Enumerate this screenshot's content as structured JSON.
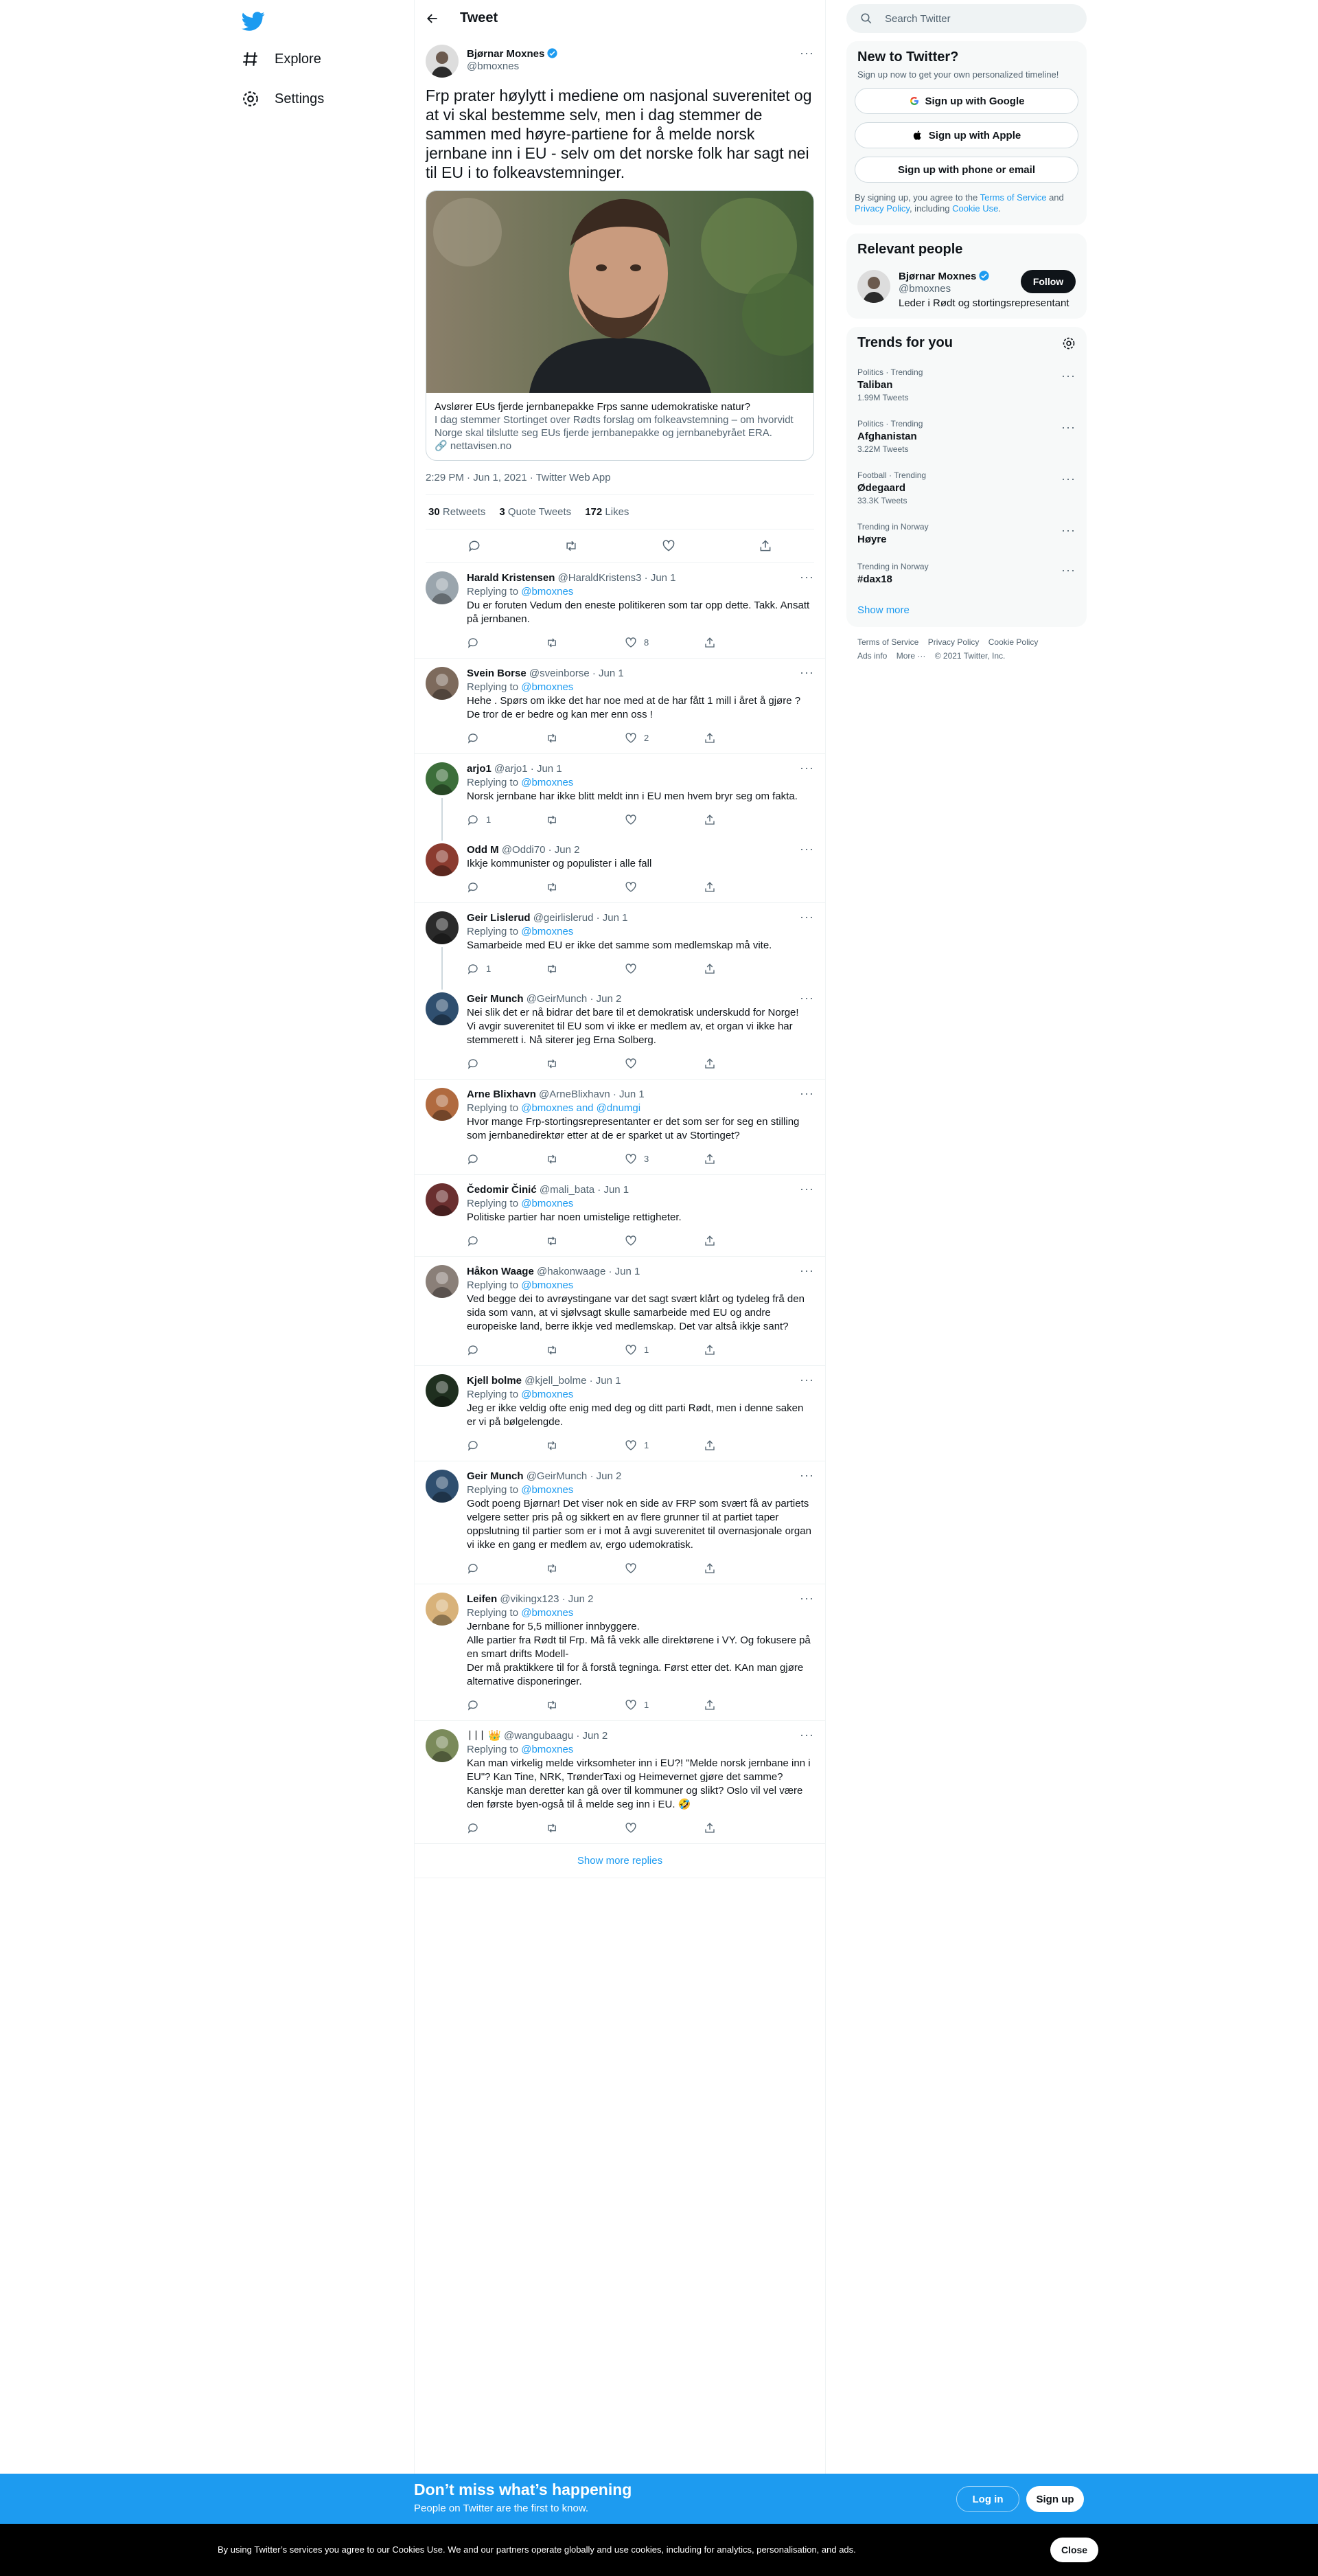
{
  "colors": {
    "accent": "#1d9bf0",
    "text": "#0f1419",
    "secondary": "#536471"
  },
  "nav": {
    "explore": "Explore",
    "settings": "Settings"
  },
  "header": {
    "title": "Tweet"
  },
  "tweet": {
    "name": "Bjørnar Moxnes",
    "handle": "@bmoxnes",
    "text": "Frp prater høylytt i mediene om nasjonal suverenitet og at vi skal bestemme selv, men i dag stemmer de sammen med høyre-partiene for å melde norsk jernbane inn i EU - selv om det norske folk har sagt nei til EU i to folkeavstemninger.",
    "card": {
      "title": "Avslører EUs fjerde jernbanepakke Frps sanne udemokratiske natur?",
      "desc": "I dag stemmer Stortinget over Rødts forslag om folkeavstemning – om hvorvidt Norge skal tilslutte seg EUs fjerde jernbanepakke og jernbanebyrået ERA.",
      "domain": "nettavisen.no"
    },
    "time": "2:29 PM · Jun 1, 2021 · Twitter Web App",
    "retweets": "30",
    "retweets_label": "Retweets",
    "quotes": "3",
    "quotes_label": "Quote Tweets",
    "likes": "172",
    "likes_label": "Likes"
  },
  "replies": [
    {
      "name": "Harald Kristensen",
      "handle": "@HaraldKristens3 · Jun 1",
      "replying": "Replying to",
      "to": "@bmoxnes",
      "text": "Du er foruten Vedum den eneste politikeren som tar opp dette. Takk. Ansatt på jernbanen.",
      "reply_count": "",
      "retweet_count": "",
      "like_count": "8"
    },
    {
      "name": "Svein Borse",
      "handle": "@sveinborse · Jun 1",
      "replying": "Replying to",
      "to": "@bmoxnes",
      "text": "Hehe . Spørs om ikke det har noe med at de har fått 1 mill i året å gjøre ? De tror de er bedre og kan mer enn oss !",
      "reply_count": "",
      "retweet_count": "",
      "like_count": "2"
    },
    {
      "name": "arjo1",
      "handle": "@arjo1 · Jun 1",
      "replying": "Replying to",
      "to": "@bmoxnes",
      "text": "Norsk jernbane har ikke blitt meldt inn i EU men hvem bryr seg om fakta.",
      "reply_count": "1",
      "retweet_count": "",
      "like_count": ""
    },
    {
      "name": "Odd M",
      "handle": "@Oddi70 · Jun 2",
      "replying": "",
      "to": "",
      "text": "Ikkje kommunister og populister i alle fall",
      "reply_count": "",
      "retweet_count": "",
      "like_count": ""
    },
    {
      "name": "Geir Lislerud",
      "handle": "@geirlislerud · Jun 1",
      "replying": "Replying to",
      "to": "@bmoxnes",
      "text": "Samarbeide med EU er ikke det samme som medlemskap må vite.",
      "reply_count": "1",
      "retweet_count": "",
      "like_count": ""
    },
    {
      "name": "Geir Munch",
      "handle": "@GeirMunch · Jun 2",
      "replying": "",
      "to": "",
      "text": "Nei slik det er nå bidrar det bare til et demokratisk underskudd for Norge!\nVi avgir suverenitet til EU som vi ikke er medlem av, et organ vi ikke har stemmerett i. Nå siterer jeg Erna Solberg.",
      "reply_count": "",
      "retweet_count": "",
      "like_count": ""
    },
    {
      "name": "Arne Blixhavn",
      "handle": "@ArneBlixhavn · Jun 1",
      "replying": "Replying to",
      "to": "@bmoxnes and @dnumgi",
      "text": "Hvor mange Frp-stortingsrepresentanter er det som ser for seg en stilling som jernbanedirektør etter at de er sparket ut av Stortinget?",
      "reply_count": "",
      "retweet_count": "",
      "like_count": "3"
    },
    {
      "name": "Čedomir Činić",
      "handle": "@mali_bata · Jun 1",
      "replying": "Replying to",
      "to": "@bmoxnes",
      "text": "Politiske partier har noen umistelige rettigheter.",
      "reply_count": "",
      "retweet_count": "",
      "like_count": ""
    },
    {
      "name": "Håkon Waage",
      "handle": "@hakonwaage · Jun 1",
      "replying": "Replying to",
      "to": "@bmoxnes",
      "text": "Ved begge dei to avrøystingane var det sagt svært klårt og tydeleg frå den sida som vann, at vi sjølvsagt skulle samarbeide med EU og andre europeiske land, berre ikkje ved medlemskap. Det var altså ikkje sant?",
      "reply_count": "",
      "retweet_count": "",
      "like_count": "1"
    },
    {
      "name": "Kjell bolme",
      "handle": "@kjell_bolme · Jun 1",
      "replying": "Replying to",
      "to": "@bmoxnes",
      "text": "Jeg er ikke veldig ofte enig med deg og ditt parti Rødt, men i denne saken er vi på bølgelengde.",
      "reply_count": "",
      "retweet_count": "",
      "like_count": "1"
    },
    {
      "name": "Geir Munch",
      "handle": "@GeirMunch · Jun 2",
      "replying": "Replying to",
      "to": "@bmoxnes",
      "text": "Godt poeng Bjørnar! Det viser nok en side av FRP som svært få av partiets velgere setter pris på og sikkert en av flere grunner til at partiet taper oppslutning til partier som er i mot å avgi suverenitet til overnasjonale organ vi ikke en gang er medlem av, ergo udemokratisk.",
      "reply_count": "",
      "retweet_count": "",
      "like_count": ""
    },
    {
      "name": "Leifen",
      "handle": "@vikingx123 · Jun 2",
      "replying": "Replying to",
      "to": "@bmoxnes",
      "text": "Jernbane for 5,5 millioner innbyggere.\nAlle partier fra Rødt til Frp. Må få vekk alle direktørene i VY. Og fokusere på en smart drifts Modell-\nDer må praktikkere til for å forstå tegninga. Først etter det. KAn man gjøre alternative disponeringer.",
      "reply_count": "",
      "retweet_count": "",
      "like_count": "1"
    },
    {
      "name": "ᛁᛁᛁ 👑",
      "handle": "@wangubaagu · Jun 2",
      "replying": "Replying to",
      "to": "@bmoxnes",
      "text": "Kan man virkelig melde virksomheter inn i EU?! \"Melde norsk jernbane inn i EU\"? Kan Tine, NRK, TrønderTaxi og Heimevernet gjøre det samme?\nKanskje man deretter kan gå over til kommuner og slikt? Oslo vil vel være den første byen-også til å melde seg inn i EU. 🤣",
      "reply_count": "",
      "retweet_count": "",
      "like_count": ""
    }
  ],
  "show_more_replies": "Show more replies",
  "sidebar": {
    "search_placeholder": "Search Twitter",
    "new_title": "New to Twitter?",
    "new_sub": "Sign up now to get your own personalized timeline!",
    "google": "Sign up with Google",
    "apple": "Sign up with Apple",
    "phone": "Sign up with phone or email",
    "terms_pre": "By signing up, you agree to the",
    "terms_link": "Terms of Service",
    "terms_and": "and",
    "privacy_link": "Privacy Policy",
    "terms_mid": ", including",
    "cookie_link": "Cookie Use",
    "terms_end": ".",
    "relevant_title": "Relevant people",
    "rp_name": "Bjørnar Moxnes",
    "rp_handle": "@bmoxnes",
    "rp_bio": "Leder i Rødt og stortingsrepresentant",
    "follow": "Follow",
    "trends_title": "Trends for you",
    "trends": [
      {
        "ctx": "Politics · Trending",
        "name": "Taliban",
        "count": "1.99M Tweets"
      },
      {
        "ctx": "Politics · Trending",
        "name": "Afghanistan",
        "count": "3.22M Tweets"
      },
      {
        "ctx": "Football · Trending",
        "name": "Ødegaard",
        "count": "33.3K Tweets"
      },
      {
        "ctx": "Trending in Norway",
        "name": "Høyre",
        "count": ""
      },
      {
        "ctx": "Trending in Norway",
        "name": "#dax18",
        "count": ""
      }
    ],
    "show_more": "Show more",
    "footer": [
      "Terms of Service",
      "Privacy Policy",
      "Cookie Policy",
      "Ads info",
      "More ···",
      "© 2021 Twitter, Inc."
    ]
  },
  "bottom": {
    "title": "Don’t miss what’s happening",
    "sub": "People on Twitter are the first to know.",
    "login": "Log in",
    "signup": "Sign up"
  },
  "cookie": {
    "text": "By using Twitter’s services you agree to our Cookies Use. We and our partners operate globally and use cookies, including for analytics, personalisation, and ads.",
    "close": "Close"
  }
}
